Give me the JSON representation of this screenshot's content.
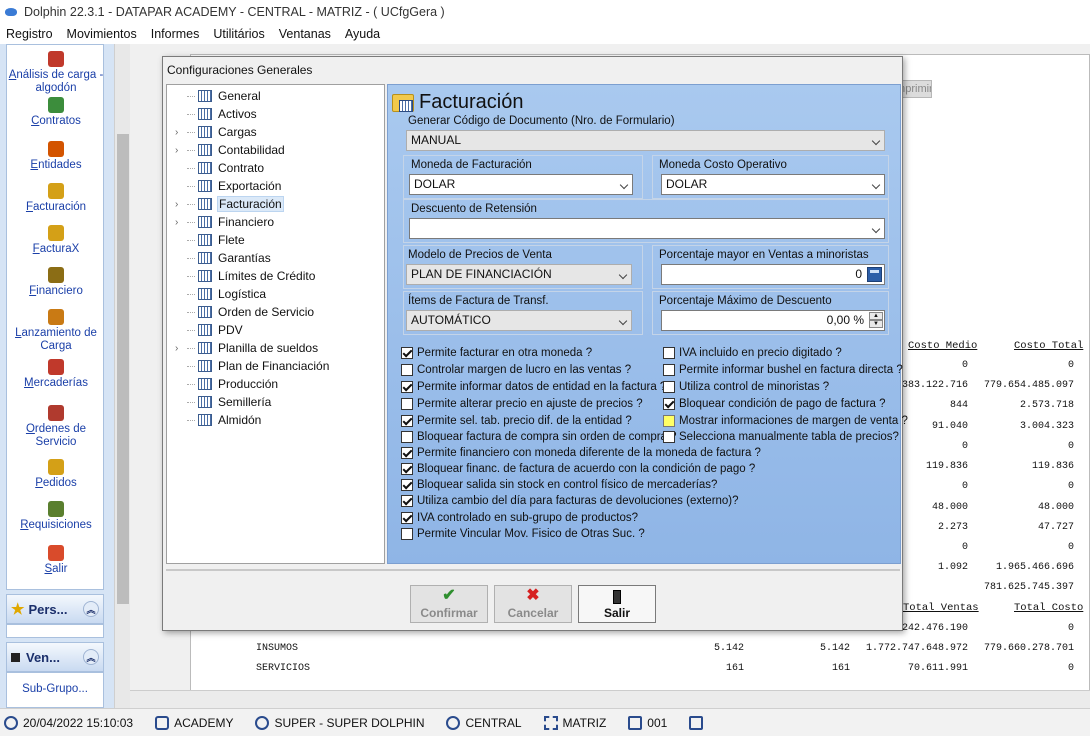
{
  "window": {
    "title": "Dolphin 22.3.1 - DATAPAR ACADEMY - CENTRAL - MATRIZ -  ( UCfgGera )"
  },
  "menu": [
    "Registro",
    "Movimientos",
    "Informes",
    "Utilitários",
    "Ventanas",
    "Ayuda"
  ],
  "sidebar": {
    "items": [
      {
        "label": "Análisis de carga - algodón",
        "icon": "scale-icon",
        "color": "#c0392b"
      },
      {
        "label": "Contratos",
        "icon": "contract-icon",
        "color": "#3c8d3c"
      },
      {
        "label": "Entidades",
        "icon": "people-icon",
        "color": "#d35400"
      },
      {
        "label": "Facturación",
        "icon": "money-bag-icon",
        "color": "#d4a017"
      },
      {
        "label": "FacturaX",
        "icon": "money-bag-icon",
        "color": "#d4a017"
      },
      {
        "label": "Financiero",
        "icon": "money-bag-icon",
        "color": "#8b6d15"
      },
      {
        "label": "Lanzamiento de Carga",
        "icon": "truck-icon",
        "color": "#c97a14"
      },
      {
        "label": "Mercaderías",
        "icon": "box-icon",
        "color": "#c0392b"
      },
      {
        "label": "Ordenes de Servicio",
        "icon": "document-icon",
        "color": "#b03a2e"
      },
      {
        "label": "Pedidos",
        "icon": "notepad-icon",
        "color": "#d4a017"
      },
      {
        "label": "Requisiciones",
        "icon": "checklist-icon",
        "color": "#5a7f2f"
      },
      {
        "label": "Salir",
        "icon": "exit-icon",
        "color": "#d94b2b"
      }
    ],
    "groups": [
      {
        "label": "Pers...",
        "icon": "star-icon"
      },
      {
        "label": "Ven...",
        "icon": "window-icon",
        "sub": "Sub-Grupo..."
      }
    ]
  },
  "background": {
    "button": "Imprimir",
    "headers": [
      "Costo Medio",
      "Costo Total",
      "Total Ventas",
      "Total Costo"
    ],
    "rows": [
      [
        "0",
        "0"
      ],
      [
        "383.122.716",
        "779.654.485.097"
      ],
      [
        "844",
        "2.573.718"
      ],
      [
        "91.040",
        "3.004.323"
      ],
      [
        "0",
        "0"
      ],
      [
        "119.836",
        "119.836"
      ],
      [
        "0",
        "0"
      ],
      [
        "48.000",
        "48.000"
      ],
      [
        "2.273",
        "47.727"
      ],
      [
        "0",
        "0"
      ],
      [
        "1.092",
        "1.965.466.696"
      ],
      [
        "",
        "781.625.745.397"
      ]
    ],
    "bottom_rows": [
      {
        "name": "",
        "a": "",
        "b": "",
        "c": "242.476.190",
        "d": "0"
      },
      {
        "name": "INSUMOS",
        "a": "5.142",
        "b": "5.142",
        "c": "1.772.747.648.972",
        "d": "779.660.278.701"
      },
      {
        "name": "SERVICIOS",
        "a": "161",
        "b": "161",
        "c": "70.611.991",
        "d": "0"
      }
    ]
  },
  "status": {
    "datetime": "20/04/2022 15:10:03",
    "db": "ACADEMY",
    "user": "SUPER - SUPER DOLPHIN",
    "location": "CENTRAL",
    "branch": "MATRIZ",
    "terminal": "001"
  },
  "dialog": {
    "title": "Configuraciones Generales",
    "tree": [
      {
        "label": "General",
        "expandable": false
      },
      {
        "label": "Activos",
        "expandable": false
      },
      {
        "label": "Cargas",
        "expandable": true
      },
      {
        "label": "Contabilidad",
        "expandable": true
      },
      {
        "label": "Contrato",
        "expandable": false
      },
      {
        "label": "Exportación",
        "expandable": false
      },
      {
        "label": "Facturación",
        "expandable": true,
        "selected": true
      },
      {
        "label": "Financiero",
        "expandable": true
      },
      {
        "label": "Flete",
        "expandable": false
      },
      {
        "label": "Garantías",
        "expandable": false
      },
      {
        "label": "Límites de Crédito",
        "expandable": false
      },
      {
        "label": "Logística",
        "expandable": false
      },
      {
        "label": "Orden de Servicio",
        "expandable": false
      },
      {
        "label": "PDV",
        "expandable": false
      },
      {
        "label": "Planilla de sueldos",
        "expandable": true
      },
      {
        "label": "Plan de Financiación",
        "expandable": false
      },
      {
        "label": "Producción",
        "expandable": false
      },
      {
        "label": "Semillería",
        "expandable": false
      },
      {
        "label": "Almidón",
        "expandable": false
      }
    ],
    "content": {
      "title": "Facturación",
      "gen_codigo": {
        "label": "Generar Código de Documento (Nro. de Formulario)",
        "value": "MANUAL"
      },
      "moneda_fact": {
        "label": "Moneda de Facturación",
        "value": "DOLAR"
      },
      "moneda_costo": {
        "label": "Moneda Costo Operativo",
        "value": "DOLAR"
      },
      "desc_ret": {
        "label": "Descuento de Retensión",
        "value": ""
      },
      "modelo_precios": {
        "label": "Modelo de Precios de Venta",
        "value": "PLAN DE FINANCIACIÓN"
      },
      "porc_mayor": {
        "label": "Porcentaje mayor en Ventas a minoristas",
        "value": "0"
      },
      "items_fact": {
        "label": "Ítems de Factura de Transf.",
        "value": "AUTOMÁTICO"
      },
      "porc_max": {
        "label": "Porcentaje Máximo de Descuento",
        "value": "0,00 %"
      },
      "checks_left": [
        {
          "label": "Permite facturar en otra moneda ?",
          "checked": true
        },
        {
          "label": "Controlar margen de lucro en las ventas ?",
          "checked": false
        },
        {
          "label": "Permite  informar datos de entidad en la factura ?",
          "checked": true
        },
        {
          "label": "Permite alterar precio en ajuste de precios ?",
          "checked": false
        },
        {
          "label": "Permite sel. tab. precio dif. de la entidad ?",
          "checked": true
        },
        {
          "label": "Bloquear factura de compra sin orden de compra ?",
          "checked": false
        },
        {
          "label": "Permite financiero con moneda diferente de la moneda de factura ?",
          "checked": true
        },
        {
          "label": "Bloquear financ. de factura de acuerdo con la condición de pago ?",
          "checked": true
        },
        {
          "label": "Bloquear salida sin stock en control físico de mercaderías?",
          "checked": true
        },
        {
          "label": "Utiliza cambio del día para facturas de devoluciones (externo)?",
          "checked": true
        },
        {
          "label": "IVA controlado en sub-grupo de productos?",
          "checked": true
        },
        {
          "label": "Permite Vincular Mov. Fisico de Otras Suc. ?",
          "checked": false
        }
      ],
      "checks_right": [
        {
          "label": "IVA incluido en precio digitado ?",
          "checked": false
        },
        {
          "label": "Permite informar bushel en factura directa ?",
          "checked": false
        },
        {
          "label": "Utiliza control de minoristas ?",
          "checked": false
        },
        {
          "label": "Bloquear condición de pago de factura ?",
          "checked": true
        },
        {
          "label": "Mostrar informaciones de margen de venta ?",
          "checked": false,
          "highlight": true
        },
        {
          "label": "Selecciona manualmente tabla de precios?",
          "checked": false
        }
      ]
    },
    "buttons": [
      {
        "label": "Confirmar",
        "icon": "check-icon",
        "enabled": false
      },
      {
        "label": "Cancelar",
        "icon": "x-icon",
        "enabled": false
      },
      {
        "label": "Salir",
        "icon": "door-icon",
        "enabled": true
      }
    ]
  }
}
